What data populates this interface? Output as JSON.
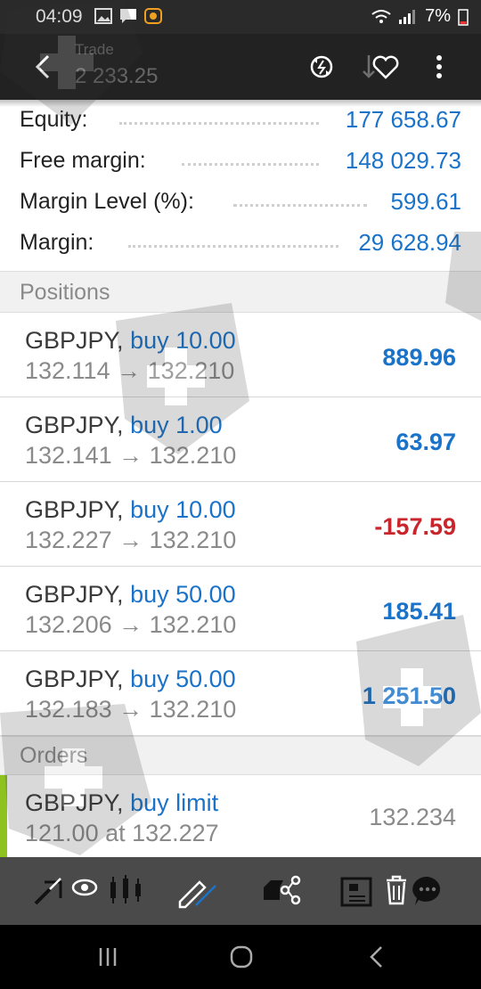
{
  "status_bar": {
    "time": "04:09",
    "battery": "7%",
    "icons": [
      "gallery-icon",
      "message-icon",
      "app-notification-icon",
      "wifi-icon",
      "signal-icon",
      "battery-icon"
    ]
  },
  "app_bar": {
    "title": "Trade",
    "balance": "2 233.25",
    "icons": [
      "back-arrow-icon",
      "one-click-trading-icon",
      "sort-icon",
      "favorite-icon",
      "more-vertical-icon"
    ]
  },
  "summary": [
    {
      "label": "Equity:",
      "value": "177 658.67"
    },
    {
      "label": "Free margin:",
      "value": "148 029.73"
    },
    {
      "label": "Margin Level (%):",
      "value": "599.61"
    },
    {
      "label": "Margin:",
      "value": "29 628.94"
    }
  ],
  "positions_header": "Positions",
  "positions": [
    {
      "symbol": "GBPJPY,",
      "side": "buy 10.00",
      "open": "132.114",
      "current": "132.210",
      "profit": "889.96",
      "sign": "pos"
    },
    {
      "symbol": "GBPJPY,",
      "side": "buy 1.00",
      "open": "132.141",
      "current": "132.210",
      "profit": "63.97",
      "sign": "pos"
    },
    {
      "symbol": "GBPJPY,",
      "side": "buy 10.00",
      "open": "132.227",
      "current": "132.210",
      "profit": "-157.59",
      "sign": "neg"
    },
    {
      "symbol": "GBPJPY,",
      "side": "buy 50.00",
      "open": "132.206",
      "current": "132.210",
      "profit": "185.41",
      "sign": "pos"
    },
    {
      "symbol": "GBPJPY,",
      "side": "buy 50.00",
      "open": "132.183",
      "current": "132.210",
      "profit": "1 251.50",
      "sign": "pos"
    }
  ],
  "arrow": "→",
  "orders_header": "Orders",
  "orders": [
    {
      "symbol": "GBPJPY,",
      "side": "buy limit",
      "details": "121.00 at 132.227",
      "price": "132.234"
    }
  ],
  "toolbar_icons": [
    "modify-order-icon",
    "watch-icon",
    "chart-candles-icon",
    "edit-icon",
    "share-icon",
    "news-icon",
    "delete-icon",
    "chat-icon"
  ],
  "colors": {
    "positive": "#1a73c9",
    "negative": "#c8262c",
    "order_accent": "#8dc21f"
  }
}
